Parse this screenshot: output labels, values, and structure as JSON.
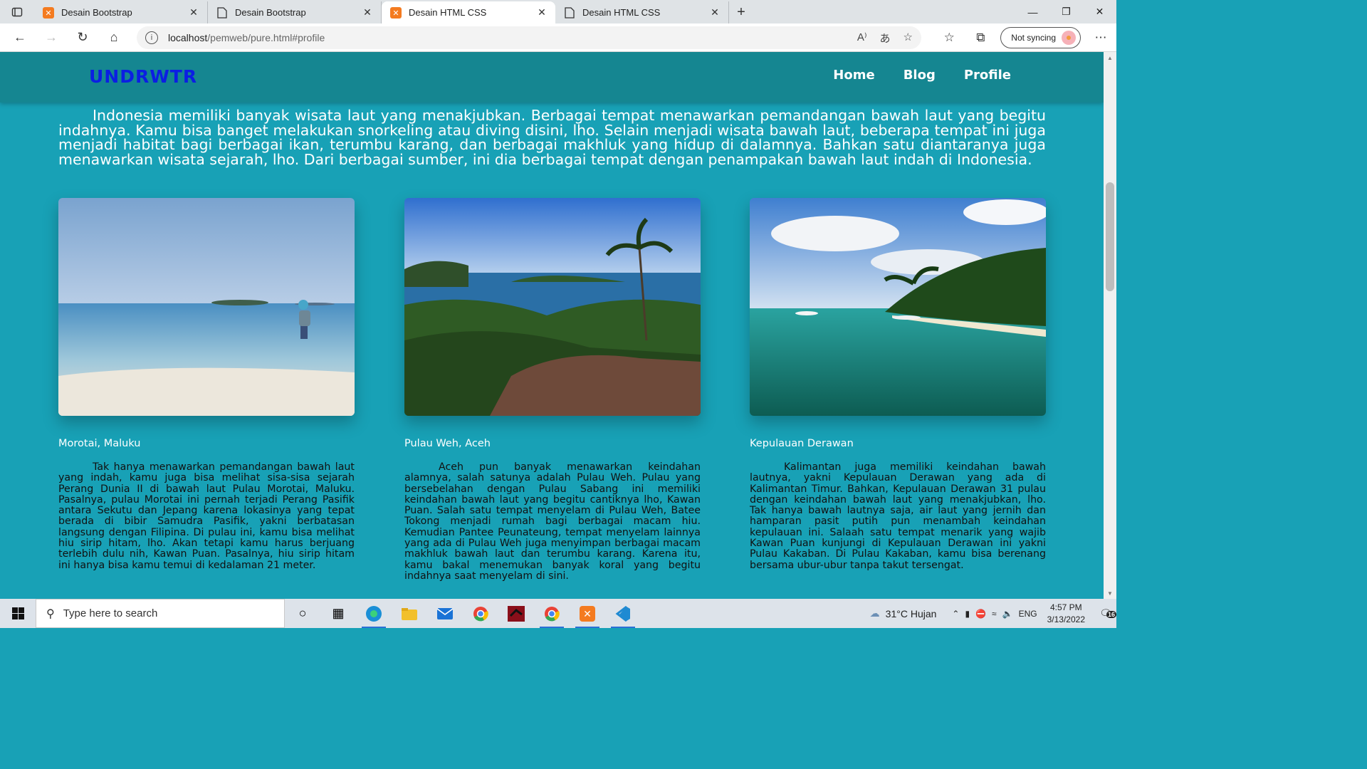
{
  "browser": {
    "tabs": [
      {
        "label": "Desain Bootstrap",
        "icon": "xampp-icon",
        "active": false
      },
      {
        "label": "Desain Bootstrap",
        "icon": "page-icon",
        "active": false
      },
      {
        "label": "Desain HTML CSS",
        "icon": "xampp-icon",
        "active": true
      },
      {
        "label": "Desain HTML CSS",
        "icon": "page-icon",
        "active": false
      }
    ],
    "url_host": "localhost",
    "url_path": "/pemweb/pure.html#profile",
    "sync_label": "Not syncing"
  },
  "site": {
    "logo": "UNDRWTR",
    "menu": [
      "Home",
      "Blog",
      "Profile"
    ],
    "intro": "Indonesia memiliki banyak wisata laut yang menakjubkan. Berbagai tempat menawarkan pemandangan bawah laut yang begitu indahnya. Kamu bisa banget melakukan snorkeling atau diving disini, lho. Selain menjadi wisata bawah laut, beberapa tempat ini juga menjadi habitat bagi berbagai ikan, terumbu karang, dan berbagai makhluk yang hidup di dalamnya. Bahkan satu diantaranya juga menawarkan wisata sejarah, lho. Dari berbagai sumber, ini dia berbagai tempat dengan penampakan bawah laut indah di Indonesia.",
    "cards": [
      {
        "title": "Morotai, Maluku",
        "text": "Tak hanya menawarkan pemandangan bawah laut yang indah, kamu juga bisa melihat sisa-sisa sejarah Perang Dunia II di bawah laut Pulau Morotai, Maluku. Pasalnya, pulau Morotai ini pernah terjadi Perang Pasifik antara Sekutu dan Jepang karena lokasinya yang tepat berada di bibir Samudra Pasifik, yakni berbatasan langsung dengan Filipina. Di pulau ini, kamu bisa melihat hiu sirip hitam, lho. Akan tetapi kamu harus berjuang terlebih dulu nih, Kawan Puan. Pasalnya, hiu sirip hitam ini hanya bisa kamu temui di kedalaman 21 meter."
      },
      {
        "title": "Pulau Weh, Aceh",
        "text": "Aceh pun banyak menawarkan keindahan alamnya, salah satunya adalah Pulau Weh. Pulau yang bersebelahan dengan Pulau Sabang ini memiliki keindahan bawah laut yang begitu cantiknya lho, Kawan Puan. Salah satu tempat menyelam di Pulau Weh, Batee Tokong menjadi rumah bagi berbagai macam hiu. Kemudian Pantee Peunateung, tempat menyelam lainnya yang ada di Pulau Weh juga menyimpan berbagai macam makhluk bawah laut dan terumbu karang. Karena itu, kamu bakal menemukan banyak koral yang begitu indahnya saat menyelam di sini."
      },
      {
        "title": "Kepulauan Derawan",
        "text": "Kalimantan juga memiliki keindahan bawah lautnya, yakni Kepulauan Derawan yang ada di Kalimantan Timur. Bahkan, Kepulauan Derawan 31 pulau dengan keindahan bawah laut yang menakjubkan, lho. Tak hanya bawah lautnya saja, air laut yang jernih dan hamparan pasit putih pun menambah keindahan kepulauan ini. Salaah satu tempat menarik yang wajib Kawan Puan kunjungi di Kepulauan Derawan ini yakni Pulau Kakaban. Di Pulau Kakaban, kamu bisa berenang bersama ubur-ubur tanpa takut tersengat."
      }
    ]
  },
  "taskbar": {
    "search_placeholder": "Type here to search",
    "weather": "31°C  Hujan",
    "lang": "ENG",
    "time": "4:57 PM",
    "date": "3/13/2022",
    "notif_count": "16"
  }
}
